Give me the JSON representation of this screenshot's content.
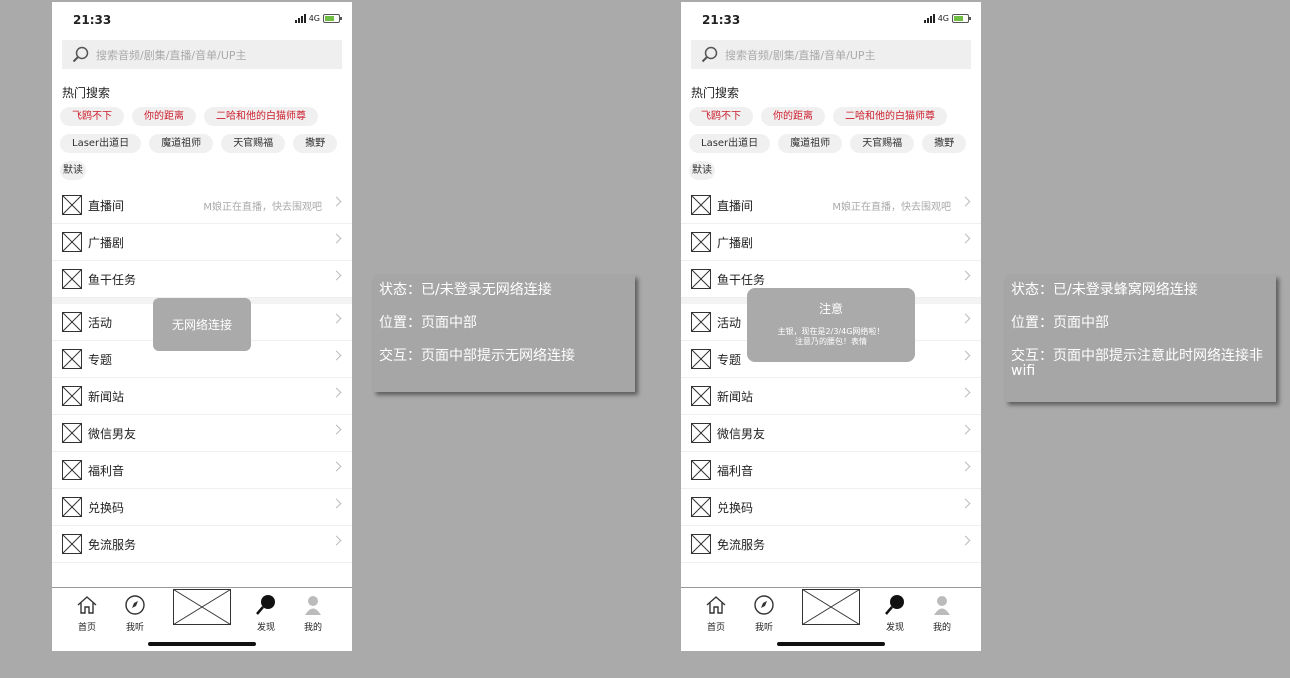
{
  "phones": [
    {
      "status": {
        "time": "21:33",
        "network": "4G"
      },
      "search": {
        "placeholder": "搜索音频/剧集/直播/音单/UP主"
      },
      "hot_title": "热门搜索",
      "hot_tags": [
        {
          "text": "飞鸥不下",
          "red": true
        },
        {
          "text": "你的距离",
          "red": true
        },
        {
          "text": "二哈和他的白猫师尊",
          "red": true
        },
        {
          "text": "Laser出道日",
          "red": false
        },
        {
          "text": "魔道祖师",
          "red": false
        },
        {
          "text": "天官赐福",
          "red": false
        },
        {
          "text": "撒野",
          "red": false
        },
        {
          "text": "默读",
          "red": false
        }
      ],
      "menu": [
        {
          "label": "直播间",
          "hint": "M娘正在直播，快去围观吧"
        },
        {
          "label": "广播剧",
          "hint": ""
        },
        {
          "label": "鱼干任务",
          "hint": ""
        },
        {
          "label": "活动",
          "hint": ""
        },
        {
          "label": "专题",
          "hint": ""
        },
        {
          "label": "新闻站",
          "hint": ""
        },
        {
          "label": "微信男友",
          "hint": ""
        },
        {
          "label": "福利音",
          "hint": ""
        },
        {
          "label": "兑换码",
          "hint": ""
        },
        {
          "label": "免流服务",
          "hint": ""
        }
      ],
      "tabs": {
        "home": "首页",
        "listen": "我听",
        "discover": "发现",
        "mine": "我的"
      },
      "toast": "无网络连接"
    },
    {
      "status": {
        "time": "21:33",
        "network": "4G"
      },
      "search": {
        "placeholder": "搜索音频/剧集/直播/音单/UP主"
      },
      "hot_title": "热门搜索",
      "hot_tags": [
        {
          "text": "飞鸥不下",
          "red": true
        },
        {
          "text": "你的距离",
          "red": true
        },
        {
          "text": "二哈和他的白猫师尊",
          "red": true
        },
        {
          "text": "Laser出道日",
          "red": false
        },
        {
          "text": "魔道祖师",
          "red": false
        },
        {
          "text": "天官赐福",
          "red": false
        },
        {
          "text": "撒野",
          "red": false
        },
        {
          "text": "默读",
          "red": false
        }
      ],
      "menu": [
        {
          "label": "直播间",
          "hint": "M娘正在直播，快去围观吧"
        },
        {
          "label": "广播剧",
          "hint": ""
        },
        {
          "label": "鱼干任务",
          "hint": ""
        },
        {
          "label": "活动",
          "hint": ""
        },
        {
          "label": "专题",
          "hint": ""
        },
        {
          "label": "新闻站",
          "hint": ""
        },
        {
          "label": "微信男友",
          "hint": ""
        },
        {
          "label": "福利音",
          "hint": ""
        },
        {
          "label": "兑换码",
          "hint": ""
        },
        {
          "label": "免流服务",
          "hint": ""
        }
      ],
      "tabs": {
        "home": "首页",
        "listen": "我听",
        "discover": "发现",
        "mine": "我的"
      },
      "dialog": {
        "title": "注意",
        "line1": "主银，现在是2/3/4G网络啦！",
        "line2": "注意乃的腰包！表情"
      }
    }
  ],
  "notes": [
    {
      "state": "状态：已/未登录无网络连接",
      "position": "位置：页面中部",
      "interaction": "交互：页面中部提示无网络连接"
    },
    {
      "state": "状态：已/未登录蜂窝网络连接",
      "position": "位置：页面中部",
      "interaction": "交互：页面中部提示注意此时网络连接非wifi"
    }
  ],
  "colors": {
    "background": "#aaaaaa",
    "hot_tag_red": "#cc1d2c",
    "panel": "#a6a6a6"
  },
  "icons": [
    "search-icon",
    "signal-icon",
    "battery-icon",
    "placeholder-image-icon",
    "chevron-right-icon",
    "home-icon",
    "listen-icon",
    "discover-icon",
    "profile-icon"
  ]
}
